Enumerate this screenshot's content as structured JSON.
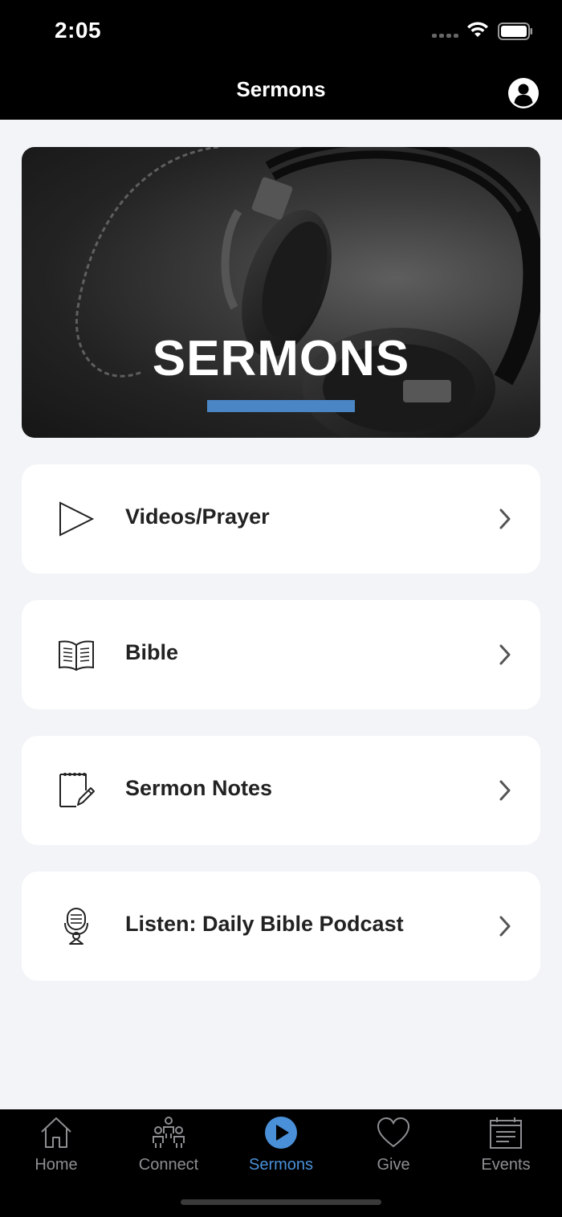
{
  "status_bar": {
    "time": "2:05"
  },
  "nav": {
    "title": "Sermons",
    "profile_icon": "person-circle-icon"
  },
  "banner": {
    "title": "SERMONS",
    "underline_color": "#4a86c5"
  },
  "menu": [
    {
      "label": "Videos/Prayer",
      "icon": "play-outline-icon"
    },
    {
      "label": "Bible",
      "icon": "open-book-icon"
    },
    {
      "label": "Sermon Notes",
      "icon": "notepad-pencil-icon"
    },
    {
      "label": "Listen: Daily Bible Podcast",
      "icon": "microphone-icon"
    }
  ],
  "tabs": [
    {
      "label": "Home",
      "icon": "home-icon",
      "active": false
    },
    {
      "label": "Connect",
      "icon": "people-icon",
      "active": false
    },
    {
      "label": "Sermons",
      "icon": "play-circle-icon",
      "active": true
    },
    {
      "label": "Give",
      "icon": "heart-icon",
      "active": false
    },
    {
      "label": "Events",
      "icon": "calendar-icon",
      "active": false
    }
  ],
  "colors": {
    "accent": "#4a90d9",
    "tab_inactive": "#8e8e93",
    "background": "#f3f4f8"
  }
}
